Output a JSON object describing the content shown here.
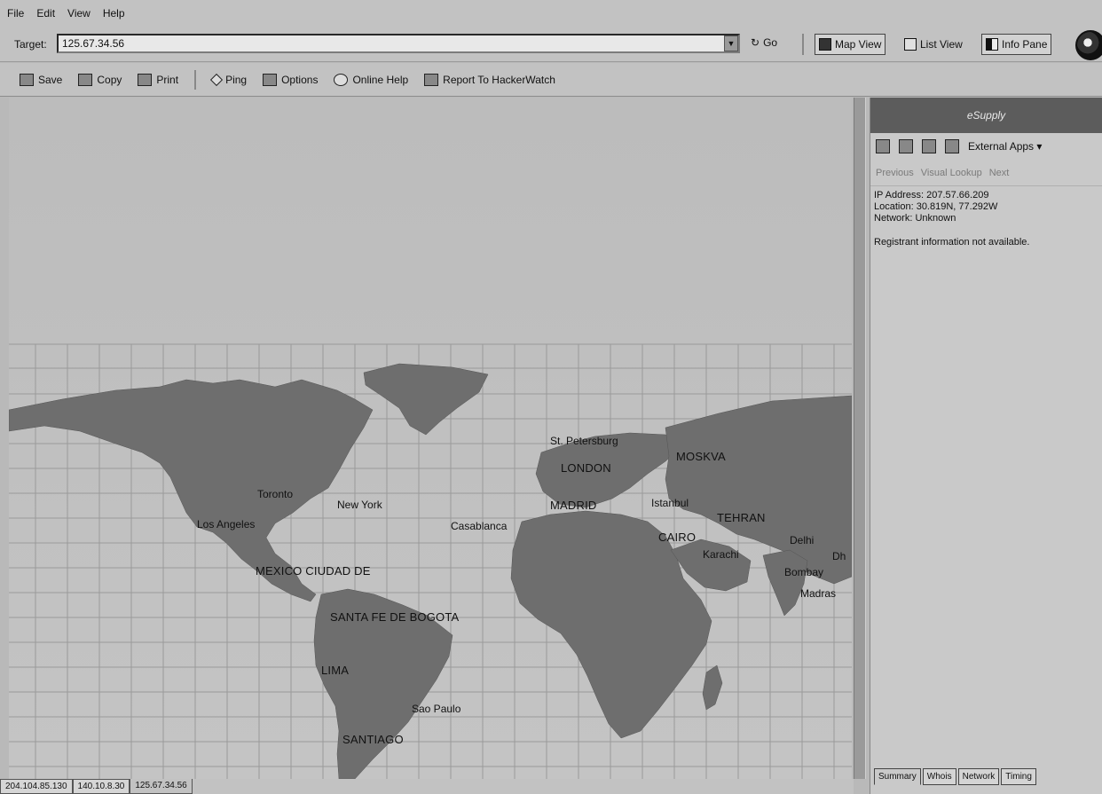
{
  "menu": [
    "File",
    "Edit",
    "View",
    "Help"
  ],
  "target": {
    "label": "Target:",
    "value": "125.67.34.56",
    "go_label": "Go"
  },
  "views": {
    "map": "Map View",
    "list": "List View",
    "info": "Info Pane"
  },
  "toolbar": {
    "save": "Save",
    "copy": "Copy",
    "print": "Print",
    "ping": "Ping",
    "options": "Options",
    "help": "Online Help",
    "report": "Report To HackerWatch"
  },
  "cities": {
    "st_petersburg": "St. Petersburg",
    "london": "LONDON",
    "moskva": "MOSKVA",
    "toronto": "Toronto",
    "new_york": "New York",
    "los_angeles": "Los Angeles",
    "casablanca": "Casablanca",
    "madrid": "MADRID",
    "istanbul": "Istanbul",
    "tehran": "TEHRAN",
    "cairo": "CAIRO",
    "karachi": "Karachi",
    "delhi": "Delhi",
    "dhaka": "Dh",
    "bombay": "Bombay",
    "madras": "Madras",
    "mexico": "MEXICO CIUDAD DE",
    "bogota": "SANTA FE DE BOGOTA",
    "lima": "LIMA",
    "sao_paulo": "Sao Paulo",
    "santiago": "SANTIAGO"
  },
  "pane": {
    "title": "eSupply",
    "external_apps": "External Apps",
    "nav_previous": "Previous",
    "nav_visual": "Visual Lookup",
    "nav_next": "Next",
    "ip_line": "IP Address: 207.57.66.209",
    "location_line": "Location: 30.819N, 77.292W",
    "network_line": "Network: Unknown",
    "registrant_line": "Registrant information not available.",
    "tabs": [
      "Summary",
      "Whois",
      "Network",
      "Timing"
    ]
  },
  "bottom_tabs": [
    "204.104.85.130",
    "140.10.8.30",
    "125.67.34.56"
  ]
}
